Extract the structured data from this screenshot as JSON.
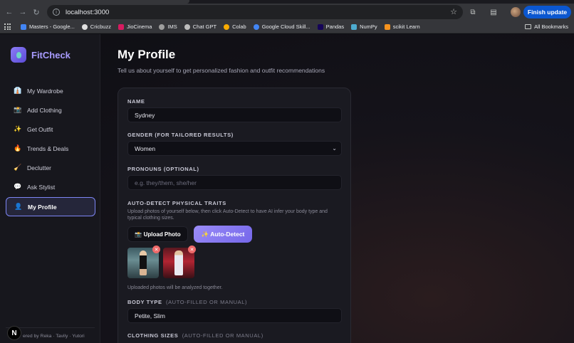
{
  "browser": {
    "url": "localhost:3000",
    "finish_update_label": "Finish update",
    "bookmarks": [
      {
        "label": "Masters - Google...",
        "color": "#4285f4"
      },
      {
        "label": "Cricbuzz",
        "color": "#e0e0e0"
      },
      {
        "label": "JioCinema",
        "color": "#d81b60"
      },
      {
        "label": "IMS",
        "color": "#9e9e9e"
      },
      {
        "label": "Chat GPT",
        "color": "#bdbdbd"
      },
      {
        "label": "Colab",
        "color": "#f9ab00"
      },
      {
        "label": "Google Cloud Skill...",
        "color": "#4285f4"
      },
      {
        "label": "Pandas",
        "color": "#150458"
      },
      {
        "label": "NumPy",
        "color": "#4dabcf"
      },
      {
        "label": "scikit Learn",
        "color": "#f7931e"
      }
    ],
    "all_bookmarks_label": "All Bookmarks"
  },
  "app": {
    "brand": "FitCheck",
    "nav": [
      {
        "label": "My Wardrobe",
        "icon": "wardrobe-icon",
        "glyph": "👔"
      },
      {
        "label": "Add Clothing",
        "icon": "camera-icon",
        "glyph": "📸"
      },
      {
        "label": "Get Outfit",
        "icon": "sparkles-icon",
        "glyph": "✨"
      },
      {
        "label": "Trends & Deals",
        "icon": "fire-icon",
        "glyph": "🔥"
      },
      {
        "label": "Declutter",
        "icon": "broom-icon",
        "glyph": "🧹"
      },
      {
        "label": "Ask Stylist",
        "icon": "chat-icon",
        "glyph": "💬"
      },
      {
        "label": "My Profile",
        "icon": "user-icon",
        "glyph": "👤",
        "active": true
      }
    ],
    "powered_by": "ered by Reka · Tavily · Yutori"
  },
  "page": {
    "title": "My Profile",
    "subtitle": "Tell us about yourself to get personalized fashion and outfit recommendations",
    "form": {
      "name_label": "NAME",
      "name_value": "Sydney",
      "gender_label": "GENDER (FOR TAILORED RESULTS)",
      "gender_value": "Women",
      "pronouns_label": "PRONOUNS (OPTIONAL)",
      "pronouns_placeholder": "e.g. they/them, she/her",
      "traits_label": "AUTO-DETECT PHYSICAL TRAITS",
      "traits_hint": "Upload photos of yourself below, then click Auto-Detect to have AI infer your body type and typical clothing sizes.",
      "upload_label": "📸 Upload Photo",
      "auto_detect_label": "✨ Auto-Detect",
      "photos_hint": "Uploaded photos will be analyzed together.",
      "body_type_label": "BODY TYPE",
      "body_type_suffix": "(AUTO-FILLED OR MANUAL)",
      "body_type_value": "Petite, Slim",
      "sizes_label": "CLOTHING SIZES",
      "sizes_suffix": "(AUTO-FILLED OR MANUAL)"
    }
  }
}
